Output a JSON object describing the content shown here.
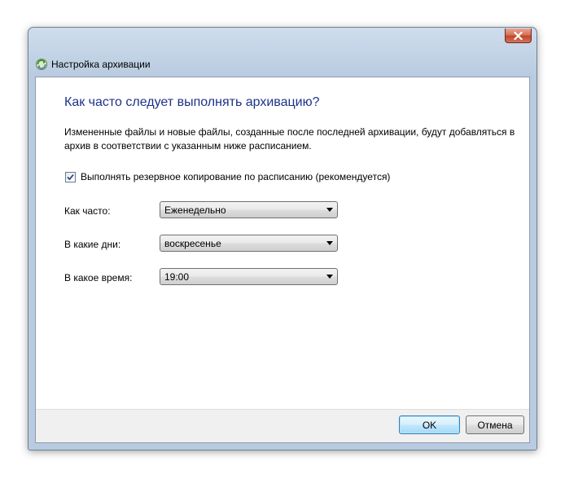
{
  "window": {
    "title": "Настройка архивации"
  },
  "icons": {
    "app": "backup-icon",
    "close": "close-icon",
    "check": "checkmark-icon",
    "dropdown": "chevron-down-icon"
  },
  "main": {
    "heading": "Как часто следует выполнять архивацию?",
    "description": "Измененные файлы и новые файлы, созданные после последней архивации, будут добавляться в архив в соответствии с указанным ниже расписанием.",
    "schedule_checkbox": {
      "label": "Выполнять резервное копирование по расписанию (рекомендуется)",
      "checked": true
    },
    "fields": [
      {
        "label": "Как часто:",
        "value": "Еженедельно"
      },
      {
        "label": "В какие дни:",
        "value": "воскресенье"
      },
      {
        "label": "В какое время:",
        "value": "19:00"
      }
    ]
  },
  "footer": {
    "ok_label": "OK",
    "cancel_label": "Отмена"
  },
  "colors": {
    "heading": "#1e3287",
    "close_button": "#c2452c",
    "default_button_border": "#3c7fb1"
  }
}
